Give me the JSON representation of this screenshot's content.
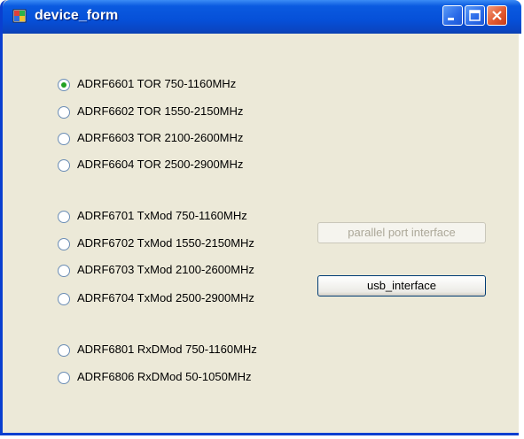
{
  "window": {
    "title": "device_form",
    "controls": {
      "minimize": "minimize-icon",
      "maximize": "maximize-icon",
      "close": "close-icon"
    }
  },
  "radios": [
    {
      "label": "ADRF6601 TOR 750-1160MHz",
      "checked": true
    },
    {
      "label": "ADRF6602 TOR 1550-2150MHz",
      "checked": false
    },
    {
      "label": "ADRF6603 TOR 2100-2600MHz",
      "checked": false
    },
    {
      "label": "ADRF6604 TOR 2500-2900MHz",
      "checked": false
    },
    {
      "label": "ADRF6701 TxMod 750-1160MHz",
      "checked": false
    },
    {
      "label": "ADRF6702 TxMod 1550-2150MHz",
      "checked": false
    },
    {
      "label": "ADRF6703 TxMod 2100-2600MHz",
      "checked": false
    },
    {
      "label": "ADRF6704 TxMod 2500-2900MHz",
      "checked": false
    },
    {
      "label": "ADRF6801 RxDMod 750-1160MHz",
      "checked": false
    },
    {
      "label": "ADRF6806 RxDMod 50-1050MHz",
      "checked": false
    }
  ],
  "buttons": {
    "parallel": {
      "label": "parallel port interface",
      "enabled": false
    },
    "usb": {
      "label": "usb_interface",
      "enabled": true
    }
  },
  "colors": {
    "titlebar": "#0650d8",
    "client_bg": "#ece9d8",
    "radio_dot": "#21a121",
    "close_button": "#e25a30"
  }
}
